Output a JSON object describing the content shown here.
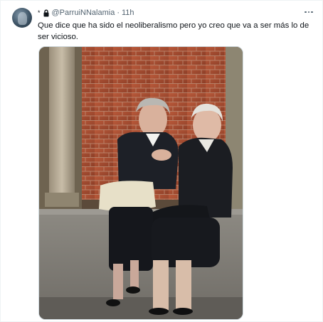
{
  "tweet": {
    "author_emoji": "*",
    "handle": "@ParruiNNalamia",
    "separator": "·",
    "timestamp": "11h",
    "text": "Que dice que ha sido el neoliberalismo pero yo creo que va a ser más lo de ser vicioso.",
    "icons": {
      "lock": "lock-icon",
      "more": "more-icon",
      "avatar": "avatar"
    },
    "media": {
      "alt_description_icon": "photo"
    }
  },
  "colors": {
    "text_primary": "#0f1419",
    "text_secondary": "#536471",
    "border": "#cfd9de"
  }
}
